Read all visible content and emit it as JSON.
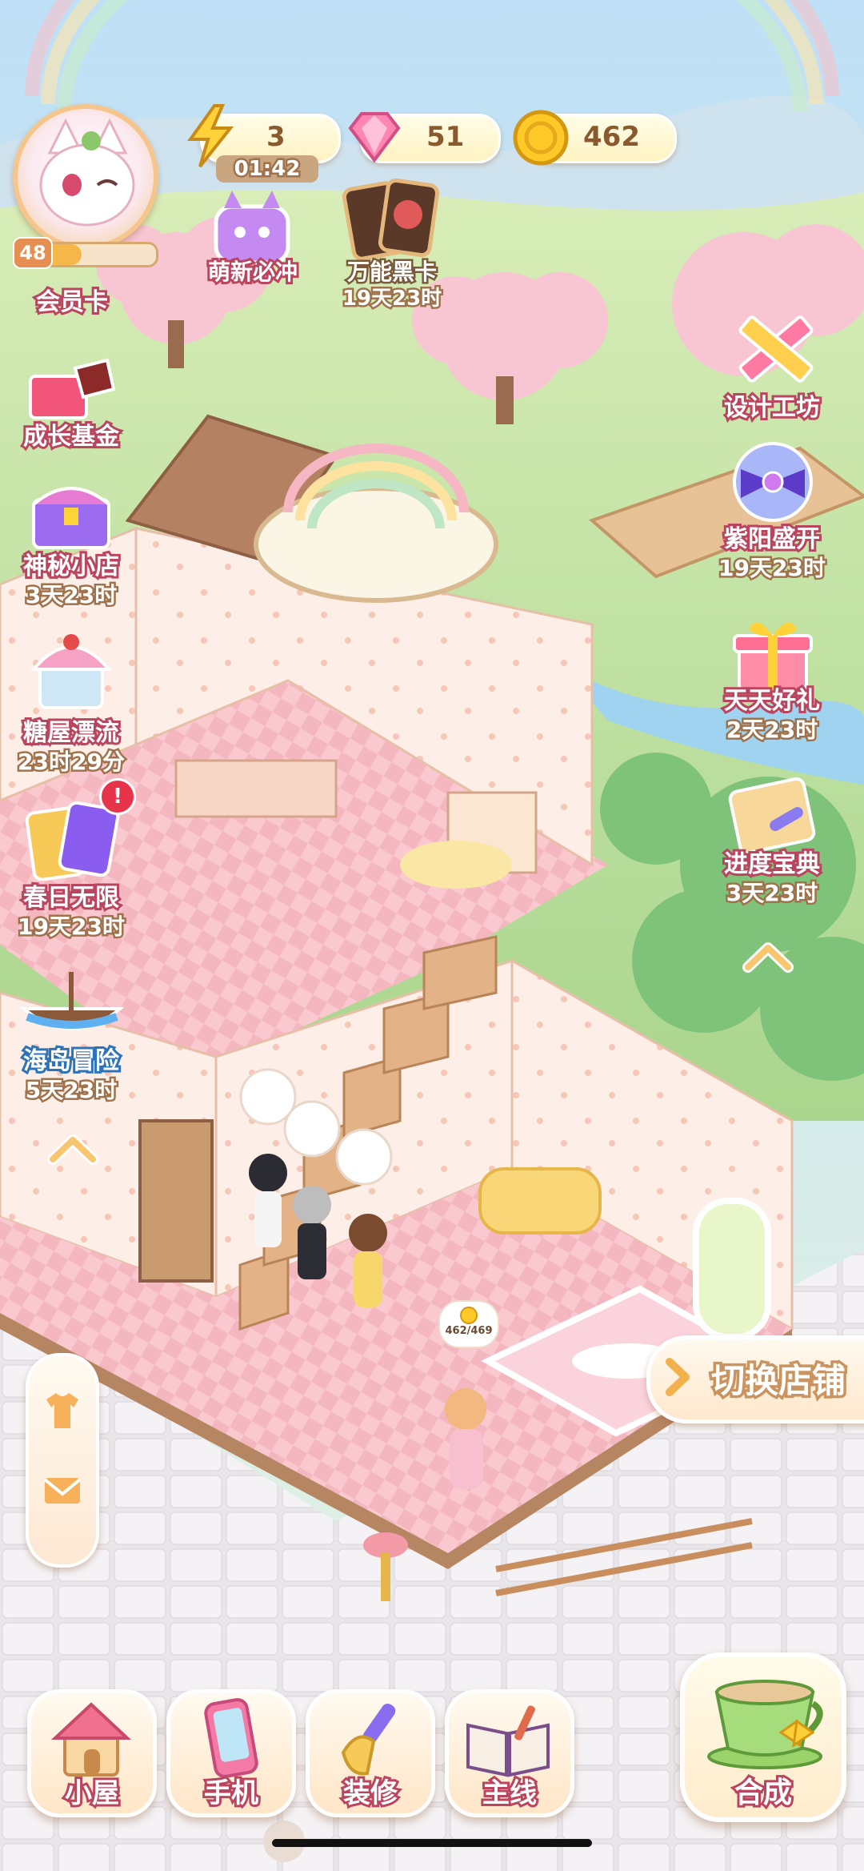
{
  "player": {
    "level": "48",
    "member_card_label": "会员卡"
  },
  "currency": {
    "energy": "3",
    "energy_timer": "01:42",
    "gems": "51",
    "coins": "462"
  },
  "top_events": [
    {
      "label": "萌新必冲",
      "timer": ""
    },
    {
      "label": "万能黑卡",
      "timer": "19天23时"
    }
  ],
  "left_menu": [
    {
      "label": "成长基金",
      "timer": ""
    },
    {
      "label": "神秘小店",
      "timer": "3天23时"
    },
    {
      "label": "糖屋漂流",
      "timer": "23时29分"
    },
    {
      "label": "春日无限",
      "timer": "19天23时"
    },
    {
      "label": "海岛冒险",
      "timer": "5天23时"
    }
  ],
  "right_menu": [
    {
      "label": "设计工坊",
      "timer": ""
    },
    {
      "label": "紫阳盛开",
      "timer": "19天23时"
    },
    {
      "label": "天天好礼",
      "timer": "2天23时"
    },
    {
      "label": "进度宝典",
      "timer": "3天23时"
    }
  ],
  "npc_counter": "462/469",
  "switch_shop_label": "切换店铺",
  "bottom_nav": [
    {
      "label": "小屋"
    },
    {
      "label": "手机"
    },
    {
      "label": "装修"
    },
    {
      "label": "主线"
    }
  ],
  "merge_label": "合成",
  "colors": {
    "accent": "#b9455e",
    "pink_floor": "#f7c6cc",
    "sky": "#cfe7f5"
  }
}
